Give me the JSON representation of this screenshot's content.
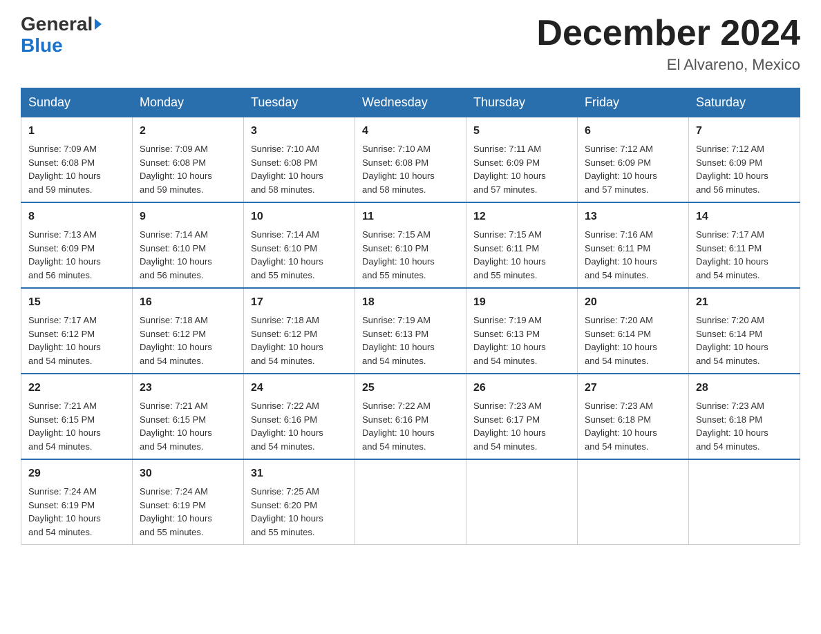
{
  "header": {
    "logo_general": "General",
    "logo_blue": "Blue",
    "month_title": "December 2024",
    "location": "El Alvareno, Mexico"
  },
  "days_of_week": [
    "Sunday",
    "Monday",
    "Tuesday",
    "Wednesday",
    "Thursday",
    "Friday",
    "Saturday"
  ],
  "weeks": [
    [
      {
        "day": "1",
        "sunrise": "7:09 AM",
        "sunset": "6:08 PM",
        "daylight": "10 hours and 59 minutes."
      },
      {
        "day": "2",
        "sunrise": "7:09 AM",
        "sunset": "6:08 PM",
        "daylight": "10 hours and 59 minutes."
      },
      {
        "day": "3",
        "sunrise": "7:10 AM",
        "sunset": "6:08 PM",
        "daylight": "10 hours and 58 minutes."
      },
      {
        "day": "4",
        "sunrise": "7:10 AM",
        "sunset": "6:08 PM",
        "daylight": "10 hours and 58 minutes."
      },
      {
        "day": "5",
        "sunrise": "7:11 AM",
        "sunset": "6:09 PM",
        "daylight": "10 hours and 57 minutes."
      },
      {
        "day": "6",
        "sunrise": "7:12 AM",
        "sunset": "6:09 PM",
        "daylight": "10 hours and 57 minutes."
      },
      {
        "day": "7",
        "sunrise": "7:12 AM",
        "sunset": "6:09 PM",
        "daylight": "10 hours and 56 minutes."
      }
    ],
    [
      {
        "day": "8",
        "sunrise": "7:13 AM",
        "sunset": "6:09 PM",
        "daylight": "10 hours and 56 minutes."
      },
      {
        "day": "9",
        "sunrise": "7:14 AM",
        "sunset": "6:10 PM",
        "daylight": "10 hours and 56 minutes."
      },
      {
        "day": "10",
        "sunrise": "7:14 AM",
        "sunset": "6:10 PM",
        "daylight": "10 hours and 55 minutes."
      },
      {
        "day": "11",
        "sunrise": "7:15 AM",
        "sunset": "6:10 PM",
        "daylight": "10 hours and 55 minutes."
      },
      {
        "day": "12",
        "sunrise": "7:15 AM",
        "sunset": "6:11 PM",
        "daylight": "10 hours and 55 minutes."
      },
      {
        "day": "13",
        "sunrise": "7:16 AM",
        "sunset": "6:11 PM",
        "daylight": "10 hours and 54 minutes."
      },
      {
        "day": "14",
        "sunrise": "7:17 AM",
        "sunset": "6:11 PM",
        "daylight": "10 hours and 54 minutes."
      }
    ],
    [
      {
        "day": "15",
        "sunrise": "7:17 AM",
        "sunset": "6:12 PM",
        "daylight": "10 hours and 54 minutes."
      },
      {
        "day": "16",
        "sunrise": "7:18 AM",
        "sunset": "6:12 PM",
        "daylight": "10 hours and 54 minutes."
      },
      {
        "day": "17",
        "sunrise": "7:18 AM",
        "sunset": "6:12 PM",
        "daylight": "10 hours and 54 minutes."
      },
      {
        "day": "18",
        "sunrise": "7:19 AM",
        "sunset": "6:13 PM",
        "daylight": "10 hours and 54 minutes."
      },
      {
        "day": "19",
        "sunrise": "7:19 AM",
        "sunset": "6:13 PM",
        "daylight": "10 hours and 54 minutes."
      },
      {
        "day": "20",
        "sunrise": "7:20 AM",
        "sunset": "6:14 PM",
        "daylight": "10 hours and 54 minutes."
      },
      {
        "day": "21",
        "sunrise": "7:20 AM",
        "sunset": "6:14 PM",
        "daylight": "10 hours and 54 minutes."
      }
    ],
    [
      {
        "day": "22",
        "sunrise": "7:21 AM",
        "sunset": "6:15 PM",
        "daylight": "10 hours and 54 minutes."
      },
      {
        "day": "23",
        "sunrise": "7:21 AM",
        "sunset": "6:15 PM",
        "daylight": "10 hours and 54 minutes."
      },
      {
        "day": "24",
        "sunrise": "7:22 AM",
        "sunset": "6:16 PM",
        "daylight": "10 hours and 54 minutes."
      },
      {
        "day": "25",
        "sunrise": "7:22 AM",
        "sunset": "6:16 PM",
        "daylight": "10 hours and 54 minutes."
      },
      {
        "day": "26",
        "sunrise": "7:23 AM",
        "sunset": "6:17 PM",
        "daylight": "10 hours and 54 minutes."
      },
      {
        "day": "27",
        "sunrise": "7:23 AM",
        "sunset": "6:18 PM",
        "daylight": "10 hours and 54 minutes."
      },
      {
        "day": "28",
        "sunrise": "7:23 AM",
        "sunset": "6:18 PM",
        "daylight": "10 hours and 54 minutes."
      }
    ],
    [
      {
        "day": "29",
        "sunrise": "7:24 AM",
        "sunset": "6:19 PM",
        "daylight": "10 hours and 54 minutes."
      },
      {
        "day": "30",
        "sunrise": "7:24 AM",
        "sunset": "6:19 PM",
        "daylight": "10 hours and 55 minutes."
      },
      {
        "day": "31",
        "sunrise": "7:25 AM",
        "sunset": "6:20 PM",
        "daylight": "10 hours and 55 minutes."
      },
      null,
      null,
      null,
      null
    ]
  ],
  "labels": {
    "sunrise": "Sunrise:",
    "sunset": "Sunset:",
    "daylight": "Daylight:"
  }
}
